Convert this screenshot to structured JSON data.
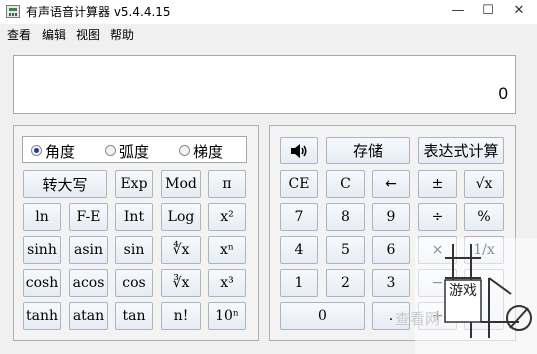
{
  "window": {
    "title": "有声语音计算器 v5.4.4.15",
    "minimize_glyph": "—",
    "maximize_glyph": "☐",
    "close_glyph": "✕"
  },
  "menu": [
    "查看",
    "编辑",
    "视图",
    "帮助"
  ],
  "display": {
    "value": "0"
  },
  "angle_modes": [
    {
      "label": "角度",
      "checked": true
    },
    {
      "label": "弧度",
      "checked": false
    },
    {
      "label": "梯度",
      "checked": false
    }
  ],
  "scientific_buttons": [
    [
      "转大写",
      "Exp",
      "Mod",
      "π"
    ],
    [
      "ln",
      "F-E",
      "Int",
      "Log",
      "x²"
    ],
    [
      "sinh",
      "asin",
      "sin",
      "∜x",
      "xⁿ"
    ],
    [
      "cosh",
      "acos",
      "cos",
      "∛x",
      "x³"
    ],
    [
      "tanh",
      "atan",
      "tan",
      "n!",
      "10ⁿ"
    ]
  ],
  "standard_buttons": {
    "speaker_icon": "speaker-icon",
    "store": "存储",
    "expression": "表达式计算",
    "row2": [
      "CE",
      "C",
      "←",
      "±",
      "√x"
    ],
    "row3": [
      "7",
      "8",
      "9",
      "÷",
      "%"
    ],
    "row4": [
      "4",
      "5",
      "6",
      "×",
      "1/x"
    ],
    "row5": [
      "1",
      "2",
      "3",
      "−"
    ],
    "row6": [
      "0",
      ".",
      "+"
    ]
  },
  "watermark": {
    "text": "游戏",
    "corner_text": "查看网"
  }
}
